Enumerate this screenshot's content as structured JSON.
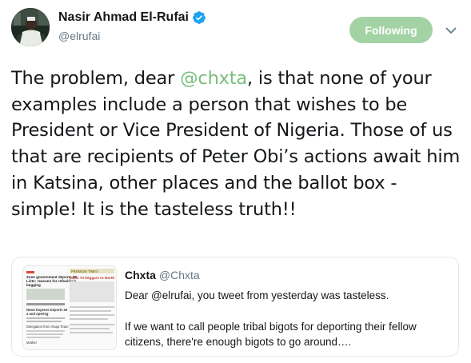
{
  "author": {
    "name": "Nasir Ahmad El-Rufai",
    "handle": "@elrufai",
    "verified": true
  },
  "follow_button": {
    "label": "Following",
    "color": "#a3d3a4"
  },
  "menu": {
    "icon": "chevron-down-icon"
  },
  "tweet": {
    "text_before": "The problem, dear ",
    "mention": "@chxta",
    "text_after": ", is that none of your examples include a person that wishes to be President or Vice President of Nigeria. Those of us that are recipients of Peter Obi’s actions await him in Katsina, other places and the ballot box - simple! It is the tasteless truth!!",
    "mention_color": "#78be7b"
  },
  "quoted_tweet": {
    "name": "Chxta",
    "handle": "@Chxta",
    "paragraph_1": "Dear @elrufai, you tweet from yesterday was tasteless.",
    "paragraph_2": "If we want to call people tribal bigots for deporting their fellow citizens, there're enough bigots to go around….",
    "thumbnail": {
      "headline_1": "Zone government deports 89",
      "headline_2": "Lists: reasons for refusing h",
      "headline_3": "begging",
      "subhead": "ports 70 beggars to North",
      "brand": "PREMIUM TIMES",
      "section_1": "News Express Deports 40",
      "section_2": "a and opering",
      "section_3": "Delegation from Abuja Team",
      "section_4": "Mother"
    }
  }
}
